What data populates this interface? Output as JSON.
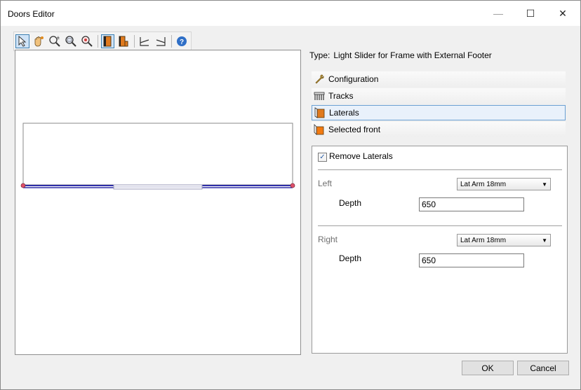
{
  "window": {
    "title": "Doors Editor",
    "minimize_glyph": "—",
    "maximize_glyph": "☐",
    "close_glyph": "✕"
  },
  "toolbar": {
    "buttons": [
      {
        "icon": "select-arrow-icon"
      },
      {
        "icon": "pan-hand-icon"
      },
      {
        "icon": "zoom-window-icon"
      },
      {
        "icon": "zoom-in-icon"
      },
      {
        "icon": "zoom-out-icon"
      },
      {
        "icon": "front-door-view-icon",
        "active": true
      },
      {
        "icon": "side-door-view-icon"
      },
      {
        "icon": "left-lateral-icon"
      },
      {
        "icon": "right-lateral-icon"
      },
      {
        "icon": "help-icon"
      }
    ]
  },
  "type": {
    "label": "Type:",
    "value": "Light Slider for Frame with External Footer"
  },
  "sections": [
    {
      "label": "Configuration",
      "icon": "wrench-icon"
    },
    {
      "label": "Tracks",
      "icon": "tracks-icon"
    },
    {
      "label": "Laterals",
      "icon": "laterals-icon",
      "selected": true
    },
    {
      "label": "Selected front",
      "icon": "selected-front-icon"
    }
  ],
  "laterals": {
    "remove_label": "Remove Laterals",
    "remove_checked": true,
    "check_glyph": "✓",
    "left": {
      "label": "Left",
      "option": "Lat Arm 18mm",
      "depth_label": "Depth",
      "depth_value": "650"
    },
    "right": {
      "label": "Right",
      "option": "Lat Arm 18mm",
      "depth_label": "Depth",
      "depth_value": "650"
    }
  },
  "dropdown_glyph": "▼",
  "buttons": {
    "ok": "OK",
    "cancel": "Cancel"
  },
  "colors": {
    "track": "#2e2ea8",
    "accent": "#3c7fb1",
    "door": "#e07a1e"
  }
}
